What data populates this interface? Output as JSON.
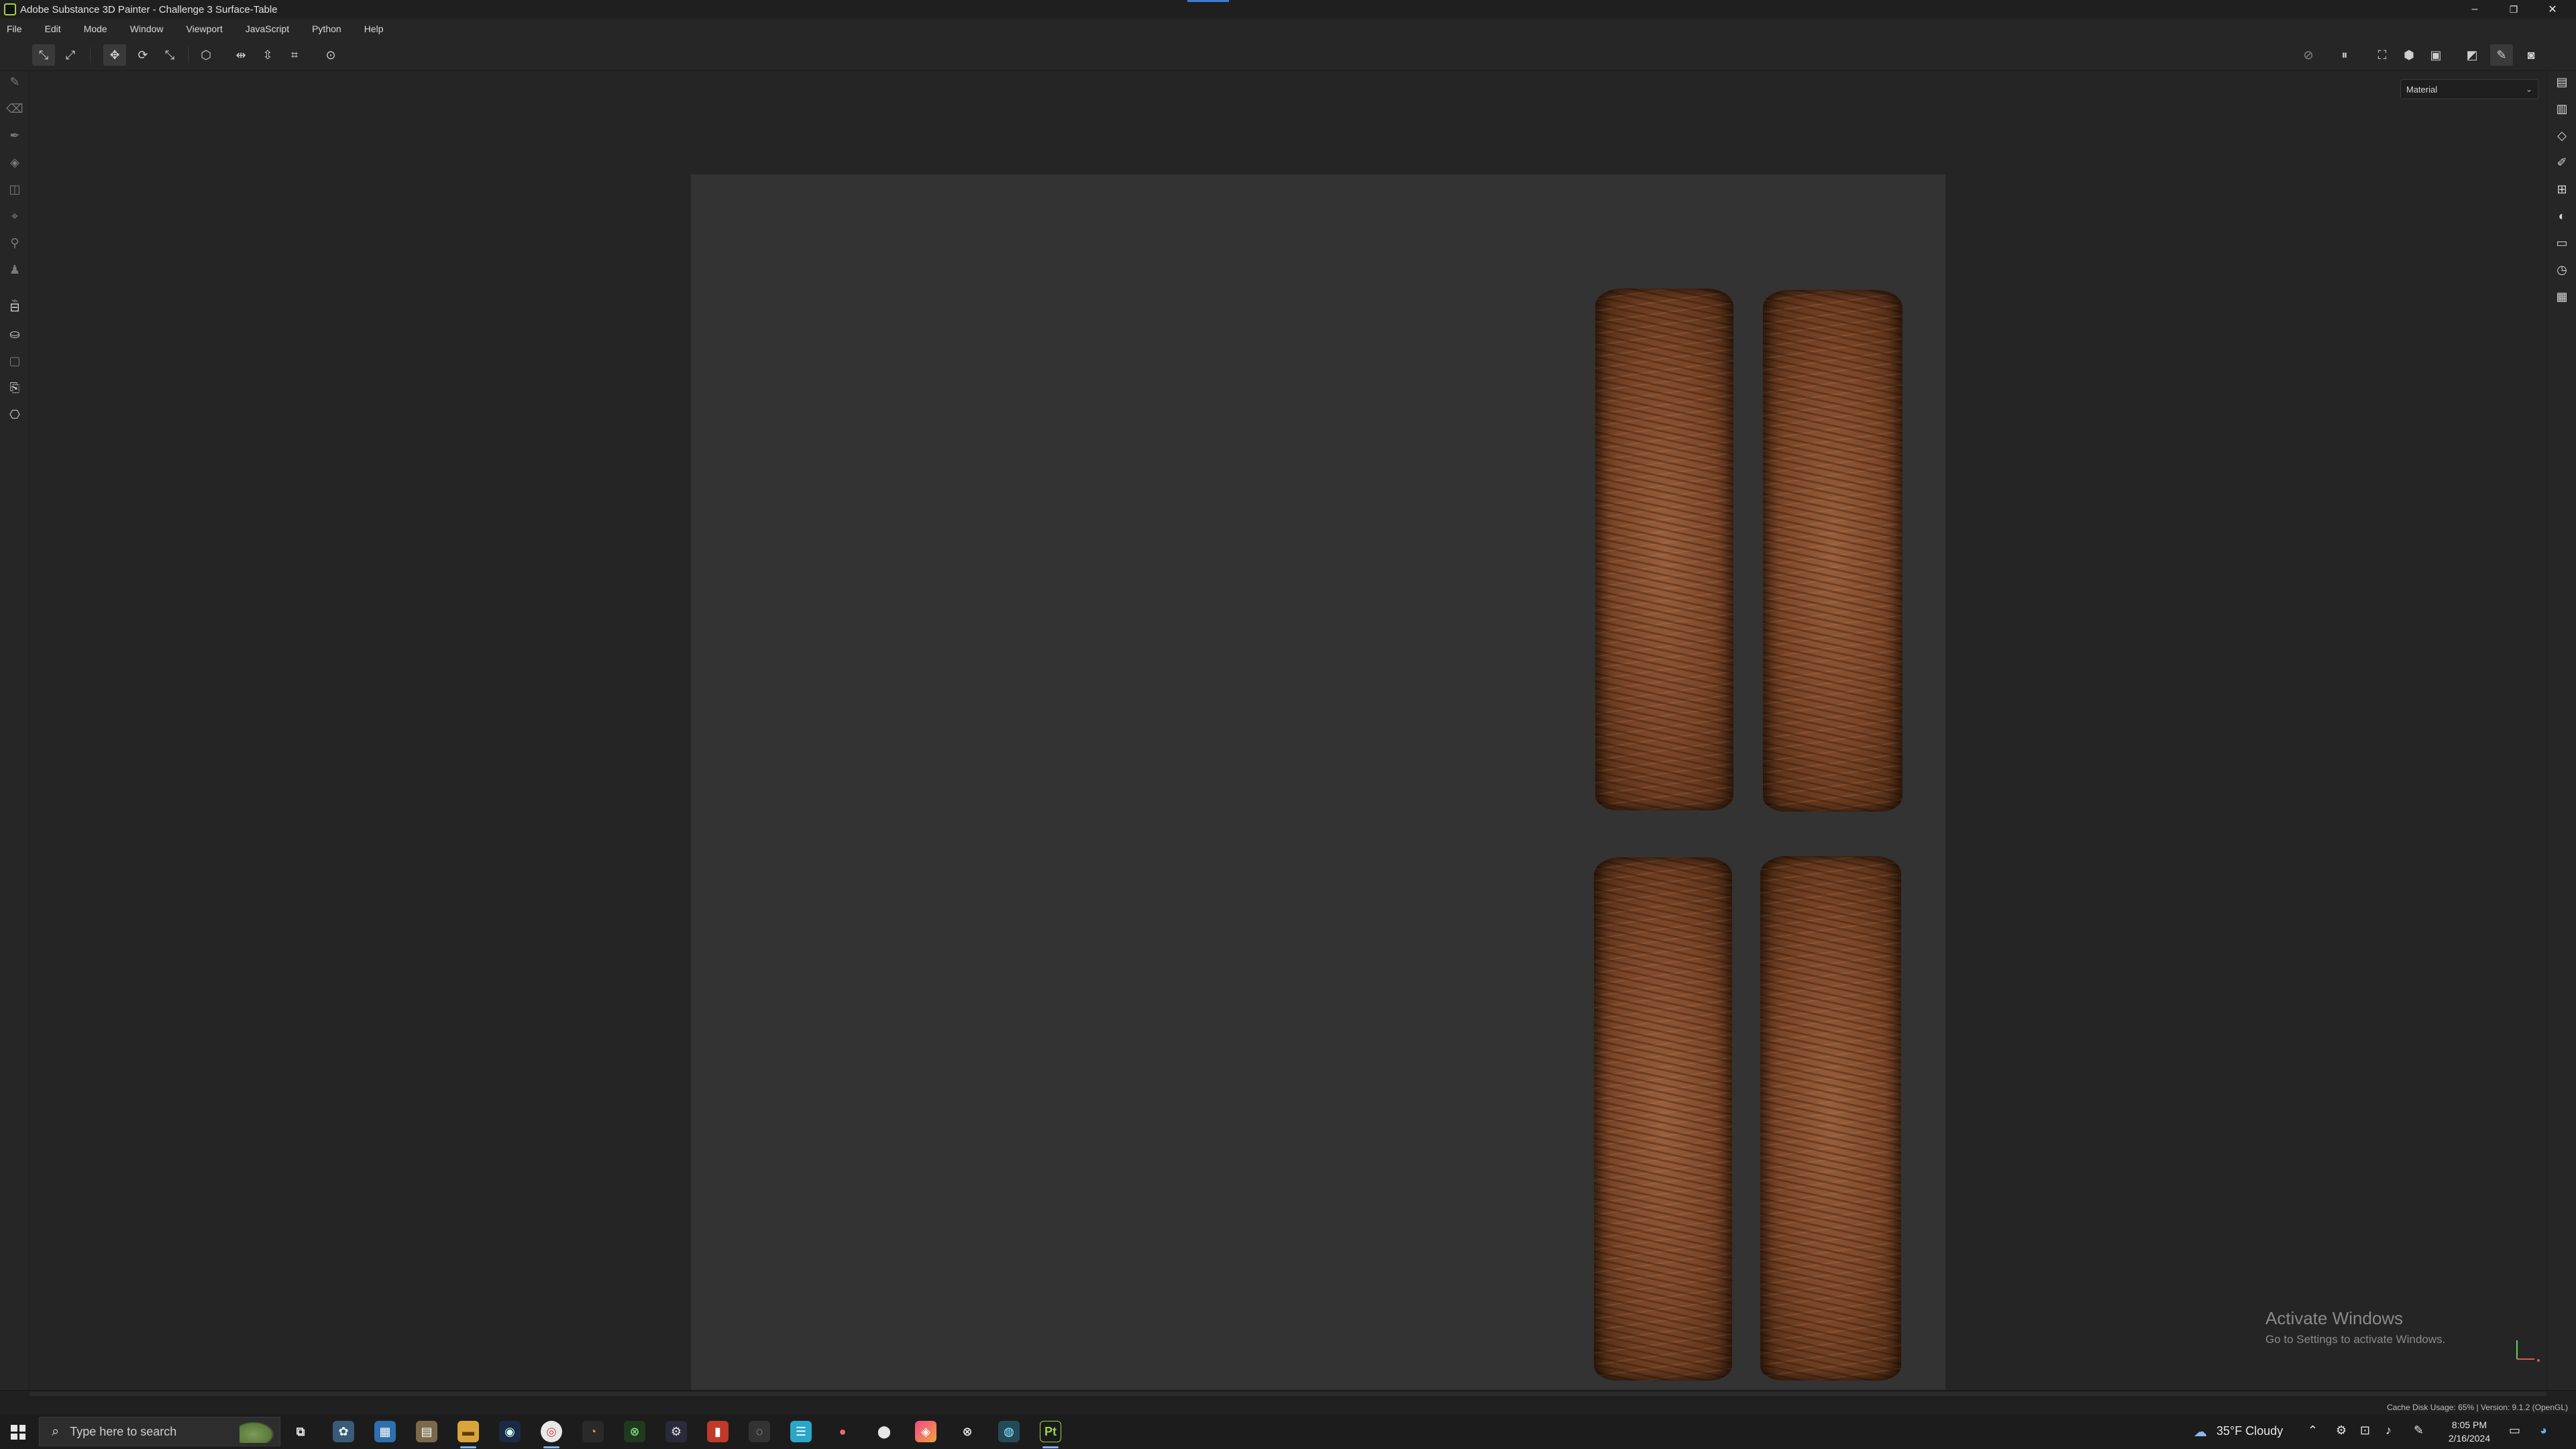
{
  "window": {
    "title": "Adobe Substance 3D Painter - Challenge 3 Surface-Table",
    "minimize": "–",
    "restore": "❐",
    "close": "✕"
  },
  "menu": [
    "File",
    "Edit",
    "Mode",
    "Window",
    "Viewport",
    "JavaScript",
    "Python",
    "Help"
  ],
  "viewport": {
    "display_mode": "Material",
    "chevron": "⌄"
  },
  "watermark": {
    "line1": "Activate Windows",
    "line2": "Go to Settings to activate Windows."
  },
  "status": {
    "text": "Cache Disk Usage: 65% | Version: 9.1.2 (OpenGL)"
  },
  "taskbar": {
    "search_placeholder": "Type here to search",
    "weather": "35°F  Cloudy",
    "time": "8:05 PM",
    "date": "2/16/2024"
  },
  "colors": {
    "accent": "#3c7bd6",
    "app_icon": "#9bd24a",
    "canvas": "#333333",
    "background": "#252525"
  }
}
